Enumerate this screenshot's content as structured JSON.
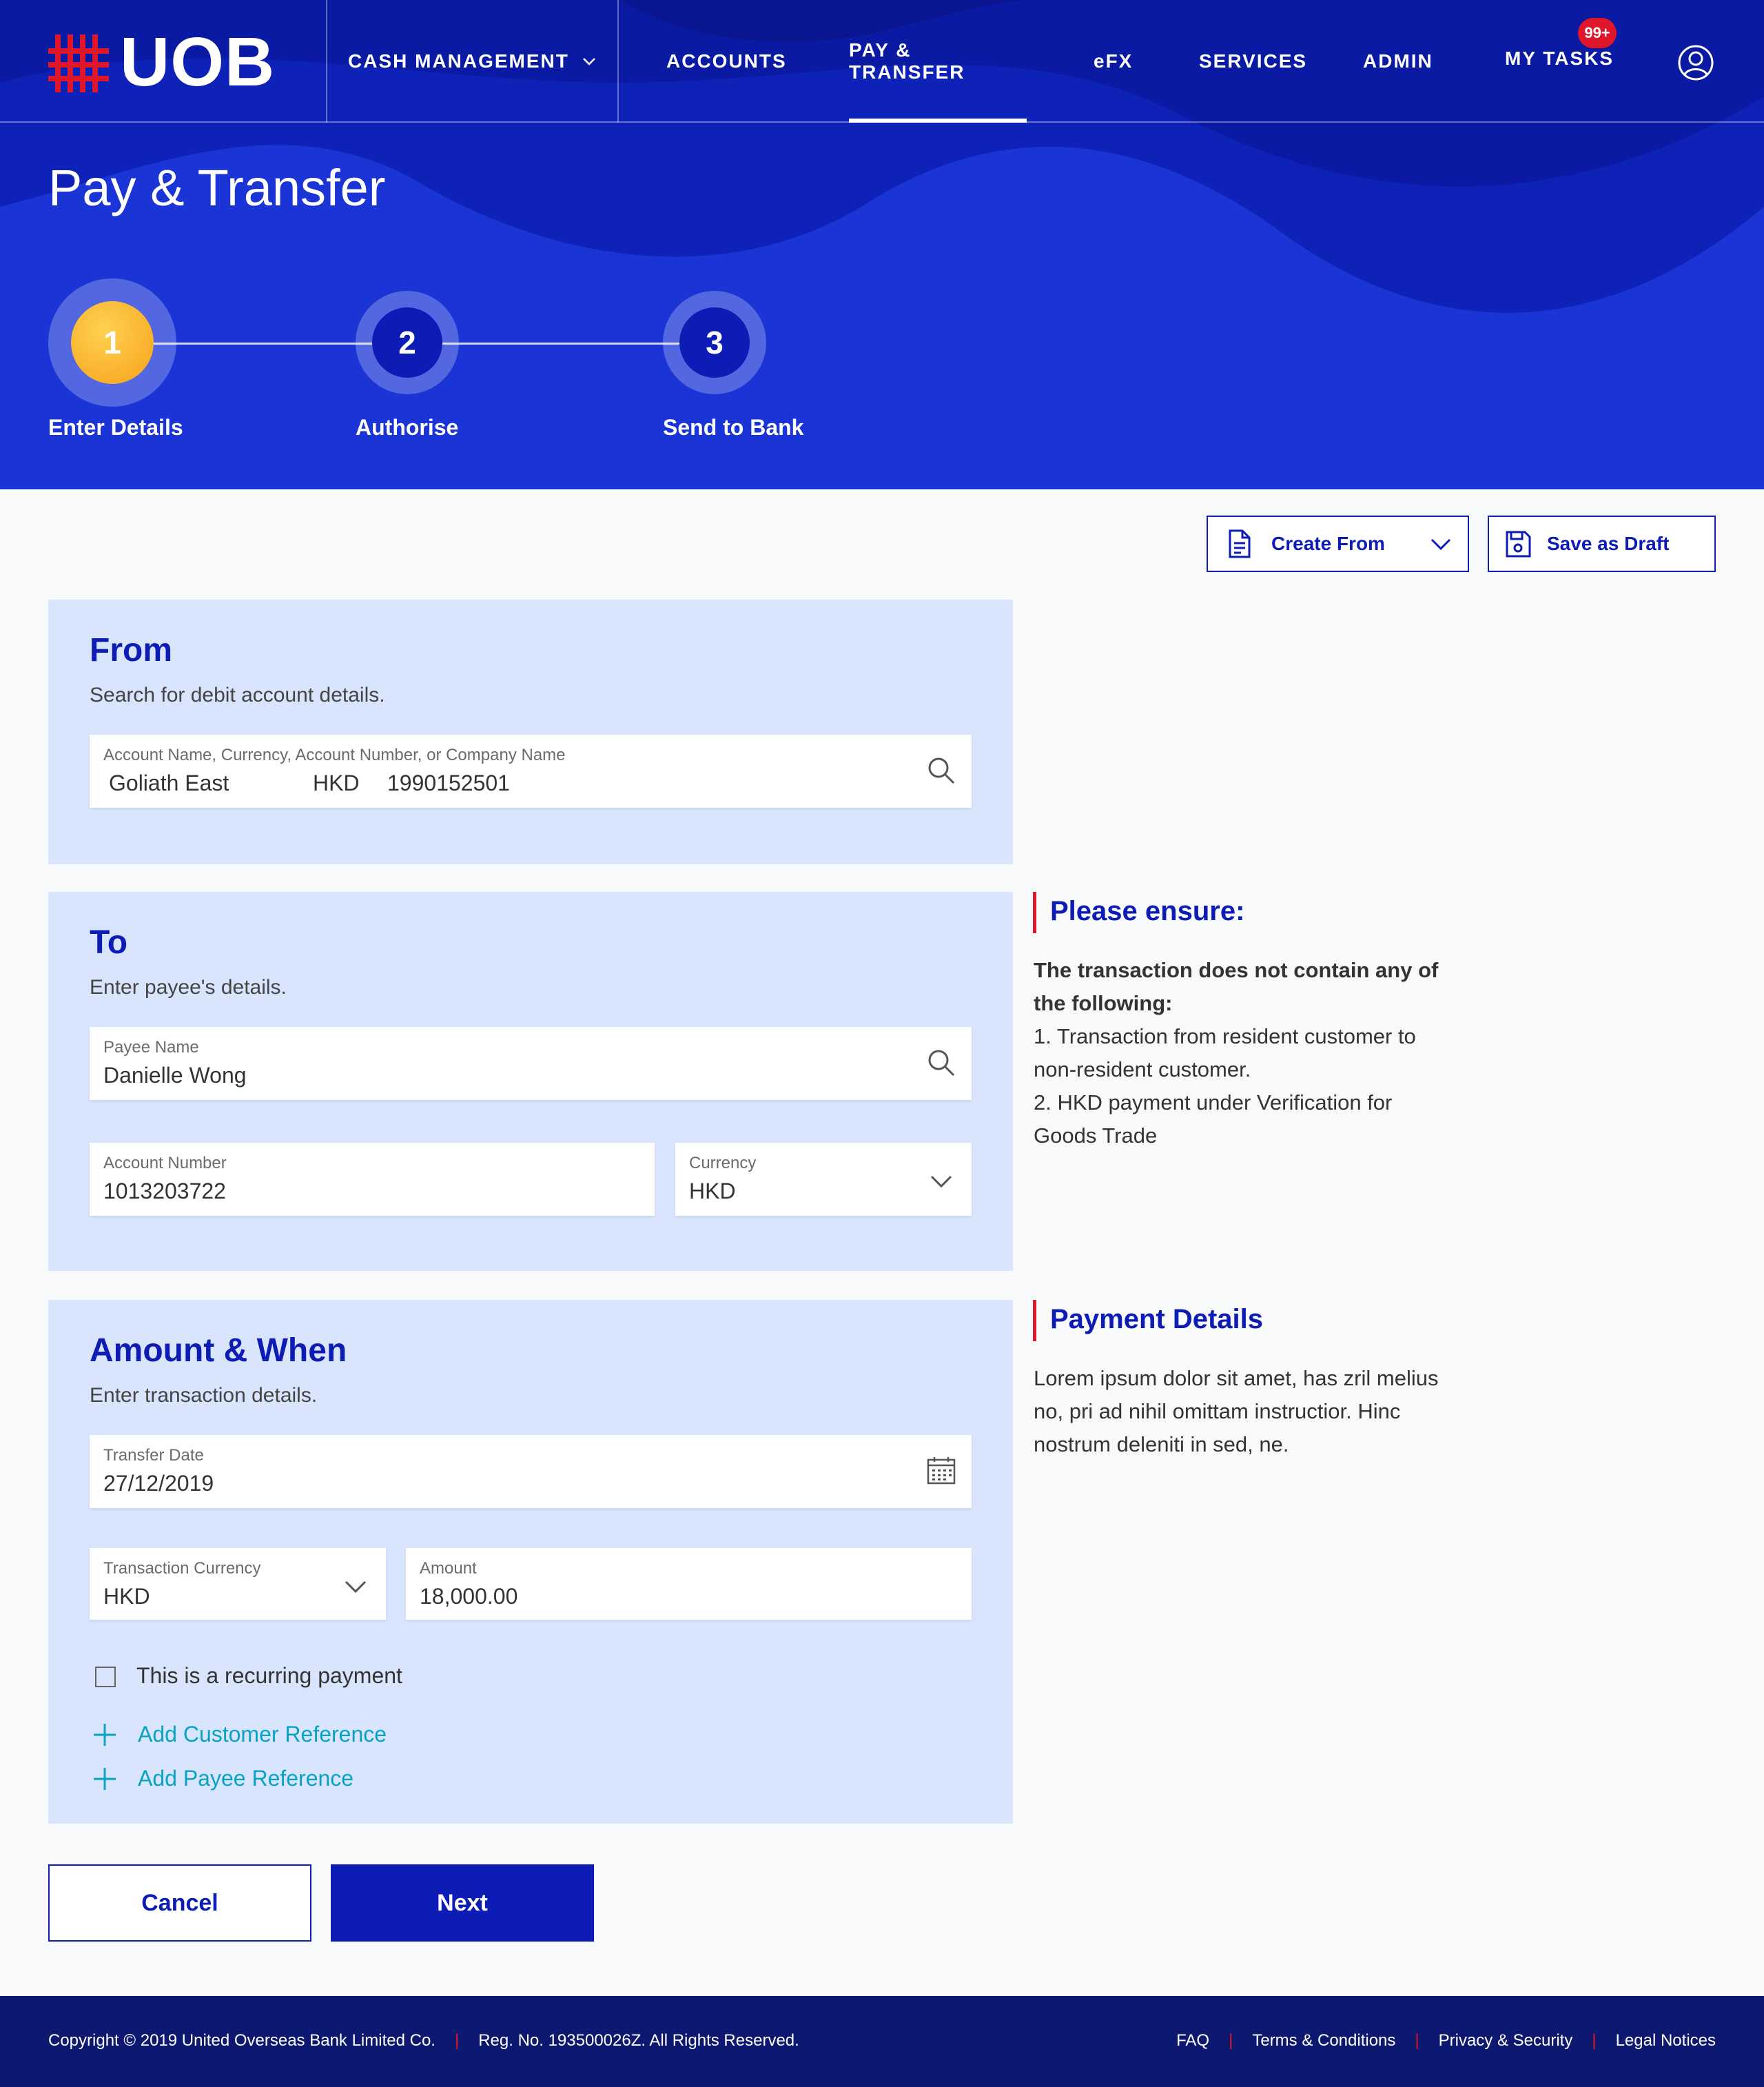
{
  "brand": {
    "name": "UOB",
    "accent": "#0c1cb4",
    "red": "#e0162b",
    "hero_bg": "#1a34d6"
  },
  "nav": {
    "items": [
      {
        "label": "CASH MANAGEMENT"
      },
      {
        "label": "ACCOUNTS"
      },
      {
        "label": "PAY & TRANSFER"
      },
      {
        "label": "eFX"
      },
      {
        "label": "SERVICES"
      },
      {
        "label": "ADMIN"
      },
      {
        "label": "MY TASKS"
      }
    ],
    "active": "PAY & TRANSFER",
    "tasks_badge": "99+"
  },
  "page": {
    "title": "Pay & Transfer"
  },
  "steps": [
    {
      "number": "1",
      "label": "Enter Details",
      "state": "active"
    },
    {
      "number": "2",
      "label": "Authorise",
      "state": "pending"
    },
    {
      "number": "3",
      "label": "Send to Bank",
      "state": "pending"
    }
  ],
  "toolbar": {
    "create_from": "Create From",
    "save_draft": "Save as Draft"
  },
  "from": {
    "title": "From",
    "subtitle": "Search for debit account details.",
    "account_label": "Account Name, Currency, Account Number, or Company Name",
    "account_name": "Goliath East",
    "account_currency": "HKD",
    "account_number": "1990152501"
  },
  "to": {
    "title": "To",
    "subtitle": "Enter payee's details.",
    "payee_label": "Payee Name",
    "payee_value": "Danielle Wong",
    "account_label": "Account Number",
    "account_value": "1013203722",
    "currency_label": "Currency",
    "currency_value": "HKD"
  },
  "amount": {
    "title": "Amount & When",
    "subtitle": "Enter transaction details.",
    "date_label": "Transfer Date",
    "date_value": "27/12/2019",
    "txn_currency_label": "Transaction Currency",
    "txn_currency_value": "HKD",
    "amount_label": "Amount",
    "amount_value": "18,000.00",
    "recurring_label": "This is a recurring payment",
    "recurring_checked": false,
    "add_customer_ref": "Add Customer Reference",
    "add_payee_ref": "Add Payee Reference"
  },
  "notes": {
    "ensure_title": "Please ensure:",
    "ensure_bold": "The transaction does not contain any of the following:",
    "ensure_item1": "1. Transaction from resident customer to non-resident customer.",
    "ensure_item2": "2. HKD payment under Verification for Goods Trade",
    "payment_title": "Payment Details",
    "payment_text": "Lorem ipsum dolor sit amet, has zril melius no, pri ad nihil omittam instructior. Hinc nostrum deleniti in sed, ne."
  },
  "actions": {
    "cancel": "Cancel",
    "next": "Next"
  },
  "footer": {
    "copyright": "Copyright © 2019 United Overseas Bank Limited Co.",
    "reg": "Reg. No. 193500026Z. All Rights Reserved.",
    "links": [
      "FAQ",
      "Terms & Conditions",
      "Privacy & Security",
      "Legal Notices"
    ]
  }
}
